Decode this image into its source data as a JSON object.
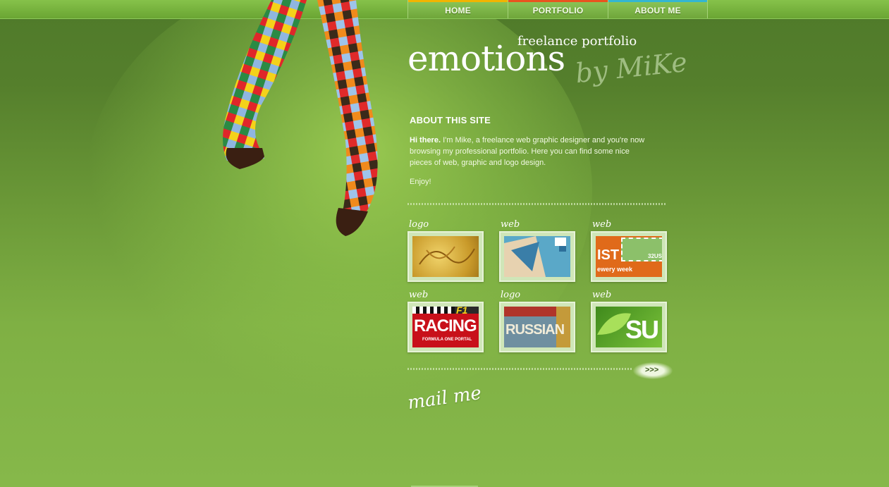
{
  "nav": {
    "items": [
      {
        "label": "HOME",
        "color": "#f2b400"
      },
      {
        "label": "PORTFOLIO",
        "color": "#e8541f"
      },
      {
        "label": "ABOUT ME",
        "color": "#34b6d0"
      }
    ]
  },
  "logo": {
    "word": "emotions",
    "tagline": "freelance portfolio",
    "signature": "by MiKe"
  },
  "about": {
    "title": "ABOUT THIS SITE",
    "lead": "Hi there.",
    "body": " I'm Mike, a freelance web graphic designer and you're now browsing my professional portfolio. Here you can find some nice pieces of web, graphic and logo design.",
    "enjoy": "Enjoy!"
  },
  "portfolio": {
    "tiles": [
      {
        "category": "logo"
      },
      {
        "category": "web"
      },
      {
        "category": "web",
        "image_text": "IST",
        "image_subtext": "ewery week",
        "stamp_value": "32US"
      },
      {
        "category": "web",
        "image_text": "RACING",
        "image_subtext": "FORMULA ONE PORTAL",
        "badge": "F1"
      },
      {
        "category": "logo",
        "image_text": "RUSSIAN"
      },
      {
        "category": "web",
        "image_text": "SU"
      }
    ],
    "more_label": ">>>"
  },
  "contact": {
    "mail_label": "mail me"
  },
  "colors": {
    "accent_green": "#6aa533",
    "home_bar": "#f2b400",
    "portfolio_bar": "#e8541f",
    "about_bar": "#34b6d0"
  }
}
